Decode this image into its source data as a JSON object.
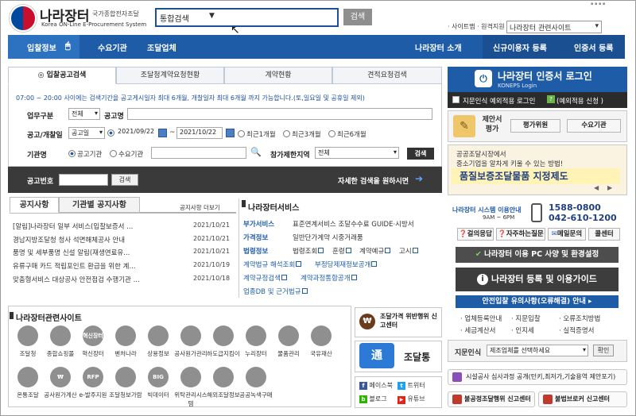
{
  "header": {
    "logo_title": "나라장터",
    "logo_sub": "국가종합전자조달",
    "logo_en": "Korea ON-Line E-Procurement System",
    "search_type": "통합검색",
    "search_button": "검색",
    "top_links": "· 사이트맵 · 원격지원",
    "site_select": "나라장터 관련사이트"
  },
  "nav": {
    "items": [
      "입찰정보",
      "수요기관",
      "조달업체"
    ],
    "right_items": [
      "나라장터 소개",
      "신규이용자 등록",
      "인증서 등록"
    ]
  },
  "search_panel": {
    "tabs": [
      "입찰공고검색",
      "조달청계약요청현황",
      "계약현황",
      "견적요청검색"
    ],
    "notice": "07:00 ~ 20:00 사이에는 검색기간을 공고게시일자 최대 6개월, 개찰일자 최대 6개월 까지 가능합니다.(토,일요일 및 공휴일 제외)",
    "biz_label": "업무구분",
    "biz_value": "전체",
    "title_label": "공고명",
    "date_label": "공고/개찰일",
    "date_type": "공고일",
    "date_from": "2021/09/22",
    "date_to": "2021/10/22",
    "date_tilde": "~",
    "period_options": [
      "최근1개월",
      "최근3개월",
      "최근6개월"
    ],
    "agency_label": "기관명",
    "agency_options": [
      "공고기관",
      "수요기관"
    ],
    "region_label": "참가제한지역",
    "region_value": "전체",
    "search_button": "검색",
    "bid_no_label": "공고번호",
    "bid_search_button": "검색",
    "detail_link": "자세한 검색을 원하시면"
  },
  "notices": {
    "tabs": [
      "공지사항",
      "기관별 공지사항"
    ],
    "more": "공지사항 더보기",
    "items": [
      {
        "title": "[알림]나라장터 일부 서비스(입찰보증서 ...",
        "date": "2021/10/21"
      },
      {
        "title": "경남지방조달청 청사 석면해체공사 안내",
        "date": "2021/10/21"
      },
      {
        "title": "품명 및 세부품명 신설 알림(재생연료유...",
        "date": "2021/10/21"
      },
      {
        "title": "유류구매 카드 적립포인트 환급을 위한 계...",
        "date": "2021/10/19"
      },
      {
        "title": "맞춤형서비스 대상공사 안전점검 수행기관 ...",
        "date": "2021/10/18"
      }
    ]
  },
  "services": {
    "title": "나라장터서비스",
    "rows": [
      {
        "label": "부가서비스",
        "values": [
          "표준연계서비스 조달수수료 GUIDE·시방서"
        ]
      },
      {
        "label": "가격정보",
        "values": [
          "일반단가계약 시중거래품"
        ]
      },
      {
        "label": "법령정보",
        "values": [
          "법령조회",
          "훈령",
          "계약예규",
          "고시"
        ]
      },
      {
        "label": "",
        "values": [
          "계약법규 해석조회",
          "부정당제재정보공개"
        ]
      },
      {
        "label": "",
        "values": [
          "계약규정검색",
          "계약과정통합공개"
        ]
      },
      {
        "label": "",
        "values": [
          "업종DB 및 근거법규"
        ]
      }
    ]
  },
  "related": {
    "title": "나라장터관련사이트",
    "row1": [
      "조달청",
      "종합쇼핑몰",
      "혁신장터",
      "벤처나라",
      "상용정보",
      "공사원가관리",
      "하도급지킴이",
      "누리장터",
      "물품관리",
      "국유재산"
    ],
    "row2": [
      "온통조달",
      "공사원가계산",
      "e-발주지원",
      "조달청보가람",
      "빅데이터",
      "위탁관리시스템",
      "해외조달정보",
      "공공녹색구매"
    ],
    "icon_texts1": [
      "",
      "",
      "혁신장터",
      "",
      "",
      "",
      "",
      "",
      "",
      ""
    ],
    "icon_texts2": [
      "",
      "₩",
      "RFP",
      "",
      "BIG DATA",
      "",
      "",
      ""
    ]
  },
  "middle": {
    "violation": "조달가격 위반행위 신고센터",
    "app": "조달통",
    "app_logo": "通",
    "social": [
      "페이스북",
      "트위터",
      "블로그",
      "유튜브"
    ]
  },
  "right": {
    "login_title": "나라장터 인증서 로그인",
    "login_sub": "KONEPS Login",
    "foreign_login": "지문인식 예외적용 로그인",
    "foreign_apply": "(예외적용 신청 )",
    "proposal_title": "제안서 평가",
    "proposal_buttons": [
      "평가위원",
      "수요기관"
    ],
    "banner_line1": "공공조달시장에서",
    "banner_line2": "중소기업을 알차게 키울 수 있는 방법!",
    "banner_big": "품질보증조달물품 지정제도",
    "callcenter_label": "나라장터 시스템 이용안내",
    "callcenter_hours": "9AM ~ 6PM",
    "phone1": "1588-0800",
    "phone2": "042-610-1200",
    "quick_buttons": [
      "걸의응답",
      "자주하는질문",
      "메일문의",
      "콜센터"
    ],
    "pc_setup": "나라장터 이용 PC 사양 및 환경설정",
    "guide": "나라장터 등록 및 이용가이드",
    "safe_bid": "안전입찰 유의사항(오류해결) 안내",
    "links": [
      "업체등록안내",
      "지문입찰",
      "오류조치방법",
      "세금계산서",
      "인지세",
      "실적증명서"
    ],
    "fingerprint_label": "지문인식",
    "fingerprint_select": "제조업체를 선택하세요",
    "fingerprint_btn": "확인",
    "facility_report": "시설공사 심사과정 공개(턴키,최저가,기술용역 제안포기)",
    "unfair_report": "불공정조달행위 신고센터",
    "broker_report": "불법브로커 신고센터"
  }
}
